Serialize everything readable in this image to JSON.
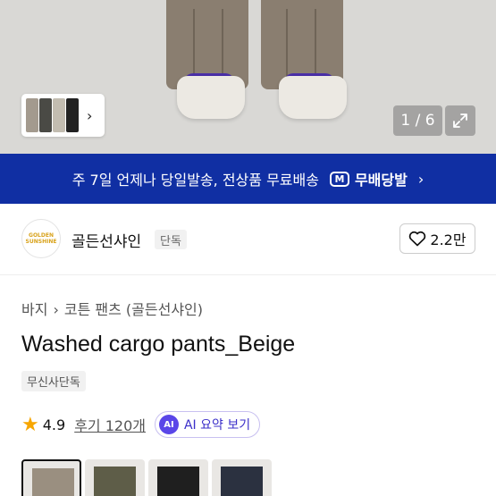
{
  "gallery": {
    "page_indicator": "1 / 6",
    "thumbnail_next_icon": "chevron-right-icon",
    "expand_icon": "expand-icon",
    "thumb_colors": [
      "#a39a8e",
      "#4a4a45",
      "#c2bcb0",
      "#222222"
    ]
  },
  "banner": {
    "text": "주 7일 언제나 당일발송, 전상품 무료배송",
    "badge": "M",
    "service": "무배당발",
    "background": "#102fa3"
  },
  "brand": {
    "logo_text": "GOLDEN SUNSHINE",
    "name": "골든선샤인",
    "tag": "단독",
    "likes": "2.2만"
  },
  "product": {
    "breadcrumb": [
      "바지",
      "코튼 팬츠 (골든선샤인)"
    ],
    "title": "Washed cargo pants_Beige",
    "badge": "무신사단독",
    "rating": "4.9",
    "reviews_label": "후기 120개",
    "ai_badge": "AI",
    "ai_label": "AI 요약 보기"
  },
  "swatches": [
    {
      "color": "#9a8f80",
      "selected": true
    },
    {
      "color": "#5e5d48",
      "selected": false
    },
    {
      "color": "#1f1f1f",
      "selected": false
    },
    {
      "color": "#2b3140",
      "selected": false
    }
  ]
}
